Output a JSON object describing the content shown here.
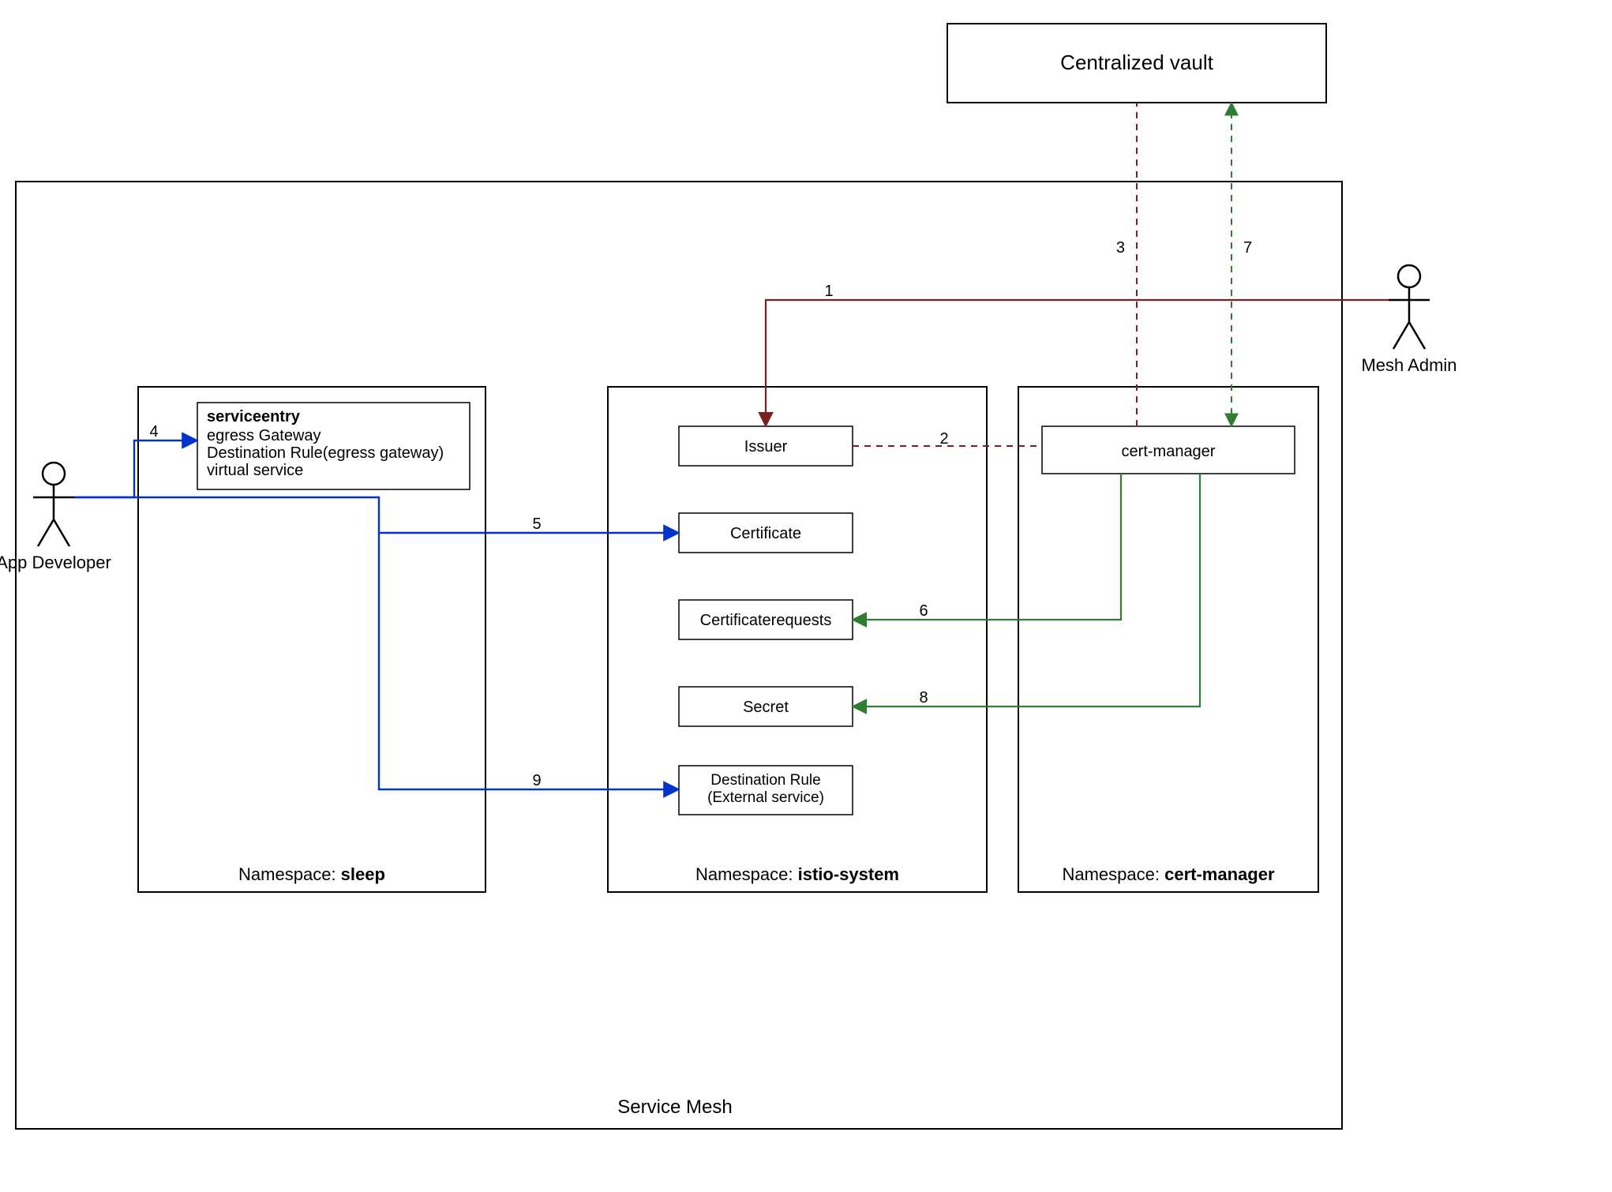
{
  "vault": {
    "title": "Centralized vault"
  },
  "mesh": {
    "title": "Service Mesh"
  },
  "actors": {
    "dev": "App Developer",
    "admin": "Mesh Admin"
  },
  "ns_sleep": {
    "caption_prefix": "Namespace: ",
    "caption_name": "sleep",
    "entry_title": "serviceentry",
    "entry_lines": {
      "a": "egress Gateway",
      "b": "Destination Rule(egress gateway)",
      "c": "virtual service"
    }
  },
  "ns_istio": {
    "caption_prefix": "Namespace: ",
    "caption_name": "istio-system",
    "boxes": {
      "issuer": "Issuer",
      "certificate": "Certificate",
      "certreq": "Certificaterequests",
      "secret": "Secret",
      "dr_line1": "Destination Rule",
      "dr_line2": "(External service)"
    }
  },
  "ns_cm": {
    "caption_prefix": "Namespace: ",
    "caption_name": "cert-manager",
    "box": "cert-manager"
  },
  "edges": {
    "n1": "1",
    "n2": "2",
    "n3": "3",
    "n4": "4",
    "n5": "5",
    "n6": "6",
    "n7": "7",
    "n8": "8",
    "n9": "9"
  },
  "colors": {
    "blue": "#0033cc",
    "darkred": "#7a1f1f",
    "green": "#2e7d32",
    "black": "#000000"
  }
}
